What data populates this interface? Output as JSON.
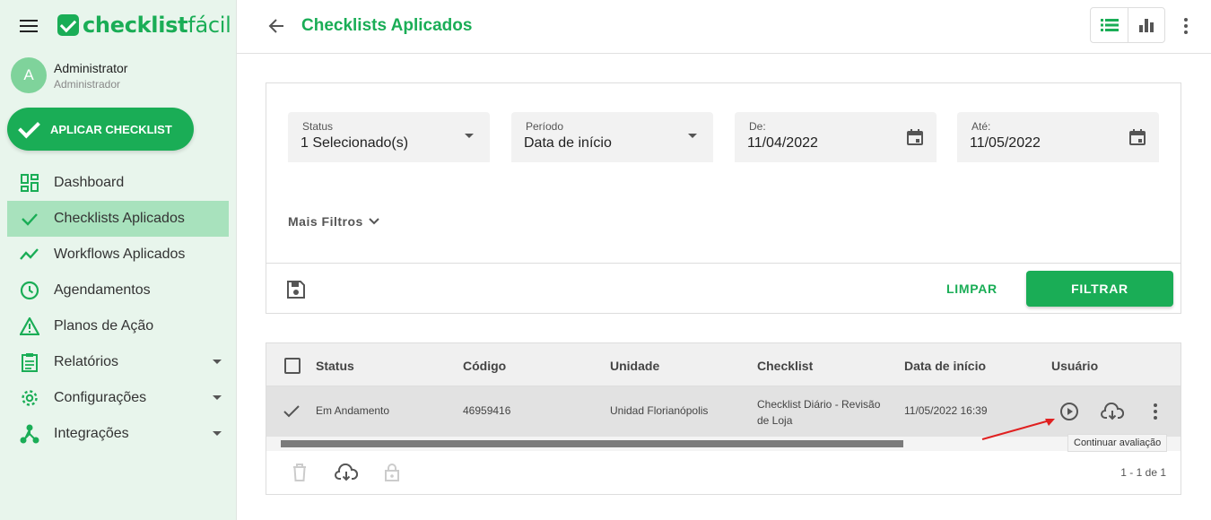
{
  "brand": {
    "logo_bold": "checklist",
    "logo_light": "fácil"
  },
  "user": {
    "initial": "A",
    "name": "Administrator",
    "role": "Administrador"
  },
  "apply_button": "APLICAR CHECKLIST",
  "nav": [
    {
      "label": "Dashboard",
      "icon": "dashboard-icon"
    },
    {
      "label": "Checklists Aplicados",
      "icon": "check-icon",
      "active": true
    },
    {
      "label": "Workflows Aplicados",
      "icon": "trend-icon"
    },
    {
      "label": "Agendamentos",
      "icon": "clock-icon"
    },
    {
      "label": "Planos de Ação",
      "icon": "warning-icon"
    },
    {
      "label": "Relatórios",
      "icon": "clipboard-icon",
      "expandable": true
    },
    {
      "label": "Configurações",
      "icon": "gear-icon",
      "expandable": true
    },
    {
      "label": "Integrações",
      "icon": "integration-icon",
      "expandable": true
    }
  ],
  "header": {
    "title": "Checklists Aplicados"
  },
  "filters": {
    "status": {
      "label": "Status",
      "value": "1 Selecionado(s)"
    },
    "period": {
      "label": "Período",
      "value": "Data de início"
    },
    "from": {
      "label": "De:",
      "value": "11/04/2022"
    },
    "to": {
      "label": "Até:",
      "value": "11/05/2022"
    },
    "more": "Mais Filtros",
    "clear": "LIMPAR",
    "apply": "FILTRAR"
  },
  "table": {
    "columns": [
      "Status",
      "Código",
      "Unidade",
      "Checklist",
      "Data de início",
      "Usuário"
    ],
    "rows": [
      {
        "status": "Em Andamento",
        "code": "46959416",
        "unit": "Unidad Florianópolis",
        "checklist_line1": "Checklist Diário - Revisão",
        "checklist_line2": "de Loja",
        "start_date": "11/05/2022 16:39"
      }
    ],
    "pagination": "1 - 1 de 1"
  },
  "tooltip": "Continuar avaliação",
  "colors": {
    "brand": "#1aad56",
    "sidebar_bg": "#e8f5ec",
    "active_nav": "#a8e2bd",
    "annotation": "#e02020"
  }
}
